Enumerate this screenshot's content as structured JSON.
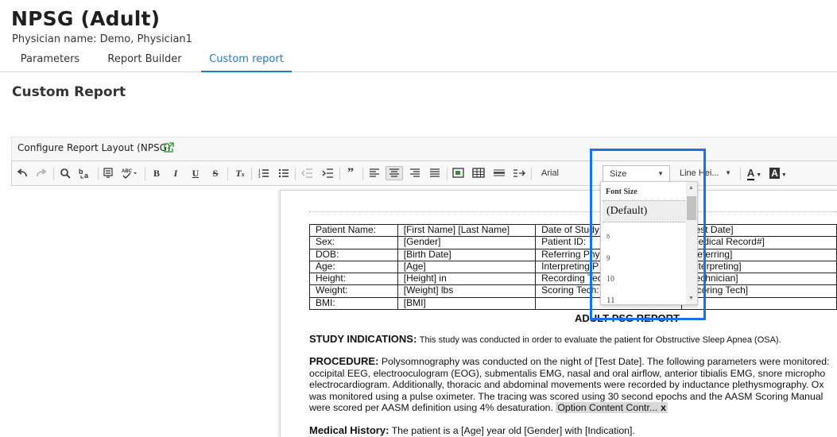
{
  "header": {
    "title": "NPSG (Adult)",
    "physician_label": "Physician name: Demo, Physician1"
  },
  "tabs": [
    {
      "label": "Parameters"
    },
    {
      "label": "Report Builder"
    },
    {
      "label": "Custom report"
    }
  ],
  "section_title": "Custom Report",
  "config": {
    "label": "Configure Report Layout (NPSG)",
    "link_icon": "external-link-icon"
  },
  "toolbar": {
    "font_name": "Arial",
    "size_label": "Size",
    "line_height_label": "Line Hei...",
    "text_color": "A",
    "bg_color": "A"
  },
  "size_dropdown": {
    "title": "Font Size",
    "selected": "(Default)",
    "options": [
      "8",
      "9",
      "10",
      "11"
    ]
  },
  "patient_table": {
    "rows": [
      [
        "Patient Name:",
        "[First Name] [Last Name]",
        "Date of Study",
        "[Test Date]"
      ],
      [
        "Sex:",
        "[Gender]",
        "Patient ID:",
        "[Medical Record#]"
      ],
      [
        "DOB:",
        "[Birth Date]",
        "Referring Phy",
        "[Referring]"
      ],
      [
        "Age:",
        "[Age]",
        "Interpreting P",
        "[Interpreting]"
      ],
      [
        "Height:",
        "[Height] in",
        "Recording Tec",
        "[Technician]"
      ],
      [
        "Weight:",
        "[Weight] lbs",
        "Scoring Tech:",
        "[Scoring Tech]"
      ],
      [
        "BMI:",
        "[BMI]",
        "",
        ""
      ]
    ]
  },
  "report": {
    "heading": "ADULT PSG REPORT",
    "study_label": "STUDY INDICATIONS:",
    "study_text": "This study was conducted in order to evaluate the patient for Obstructive Sleep Apnea (OSA).",
    "procedure_label": "PROCEDURE:",
    "procedure_line1": "Polysomnography was conducted on the night of [Test Date]. The following parameters were monitored:",
    "procedure_line2": "occipital EEG, electrooculogram (EOG), submentalis EMG, nasal and oral airflow, anterior tibialis EMG, snore micropho",
    "procedure_line3": "electrocardiogram. Additionally, thoracic and abdominal movements were recorded by inductance plethysmography. Ox",
    "procedure_line4": "was monitored using a pulse oximeter. The tracing was scored using 30 second epochs and the AASM Scoring Manual",
    "procedure_line5": "were scored per AASM definition using 4% desaturation.",
    "chip": "Option Content Contr...",
    "chip_close": "x",
    "history_label": "Medical History:",
    "history_text": "The patient is a [Age] year old [Gender] with [Indication]."
  },
  "colors": {
    "accent": "#2a77c9",
    "highlight": "#1a72e8"
  }
}
